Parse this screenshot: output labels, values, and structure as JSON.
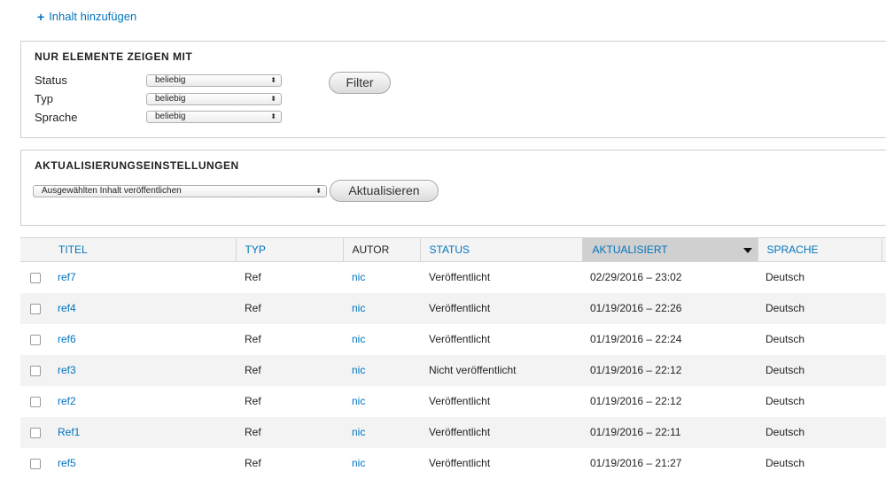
{
  "add_content": {
    "icon": "plus-icon",
    "label": "Inhalt hinzufügen"
  },
  "filter": {
    "legend": "NUR ELEMENTE ZEIGEN MIT",
    "fields": [
      {
        "label": "Status",
        "value": "beliebig"
      },
      {
        "label": "Typ",
        "value": "beliebig"
      },
      {
        "label": "Sprache",
        "value": "beliebig"
      }
    ],
    "button_label": "Filter"
  },
  "update": {
    "legend": "AKTUALISIERUNGSEINSTELLUNGEN",
    "action_value": "Ausgewählten Inhalt veröffentlichen",
    "button_label": "Aktualisieren"
  },
  "table": {
    "headers": {
      "title": "TITEL",
      "type": "TYP",
      "author": "AUTOR",
      "status": "STATUS",
      "updated": "AKTUALISIERT",
      "language": "SPRACHE"
    },
    "sorted_column": "updated",
    "rows": [
      {
        "title": "ref7",
        "type": "Ref",
        "author": "nic",
        "status": "Veröffentlicht",
        "updated": "02/29/2016 – 23:02",
        "language": "Deutsch"
      },
      {
        "title": "ref4",
        "type": "Ref",
        "author": "nic",
        "status": "Veröffentlicht",
        "updated": "01/19/2016 – 22:26",
        "language": "Deutsch"
      },
      {
        "title": "ref6",
        "type": "Ref",
        "author": "nic",
        "status": "Veröffentlicht",
        "updated": "01/19/2016 – 22:24",
        "language": "Deutsch"
      },
      {
        "title": "ref3",
        "type": "Ref",
        "author": "nic",
        "status": "Nicht veröffentlicht",
        "updated": "01/19/2016 – 22:12",
        "language": "Deutsch"
      },
      {
        "title": "ref2",
        "type": "Ref",
        "author": "nic",
        "status": "Veröffentlicht",
        "updated": "01/19/2016 – 22:12",
        "language": "Deutsch"
      },
      {
        "title": "Ref1",
        "type": "Ref",
        "author": "nic",
        "status": "Veröffentlicht",
        "updated": "01/19/2016 – 22:11",
        "language": "Deutsch"
      },
      {
        "title": "ref5",
        "type": "Ref",
        "author": "nic",
        "status": "Veröffentlicht",
        "updated": "01/19/2016 – 21:27",
        "language": "Deutsch"
      }
    ]
  },
  "colors": {
    "link": "#0074bd",
    "sorted_header": "#d0d0d0",
    "row_alt": "#f3f3f3"
  }
}
